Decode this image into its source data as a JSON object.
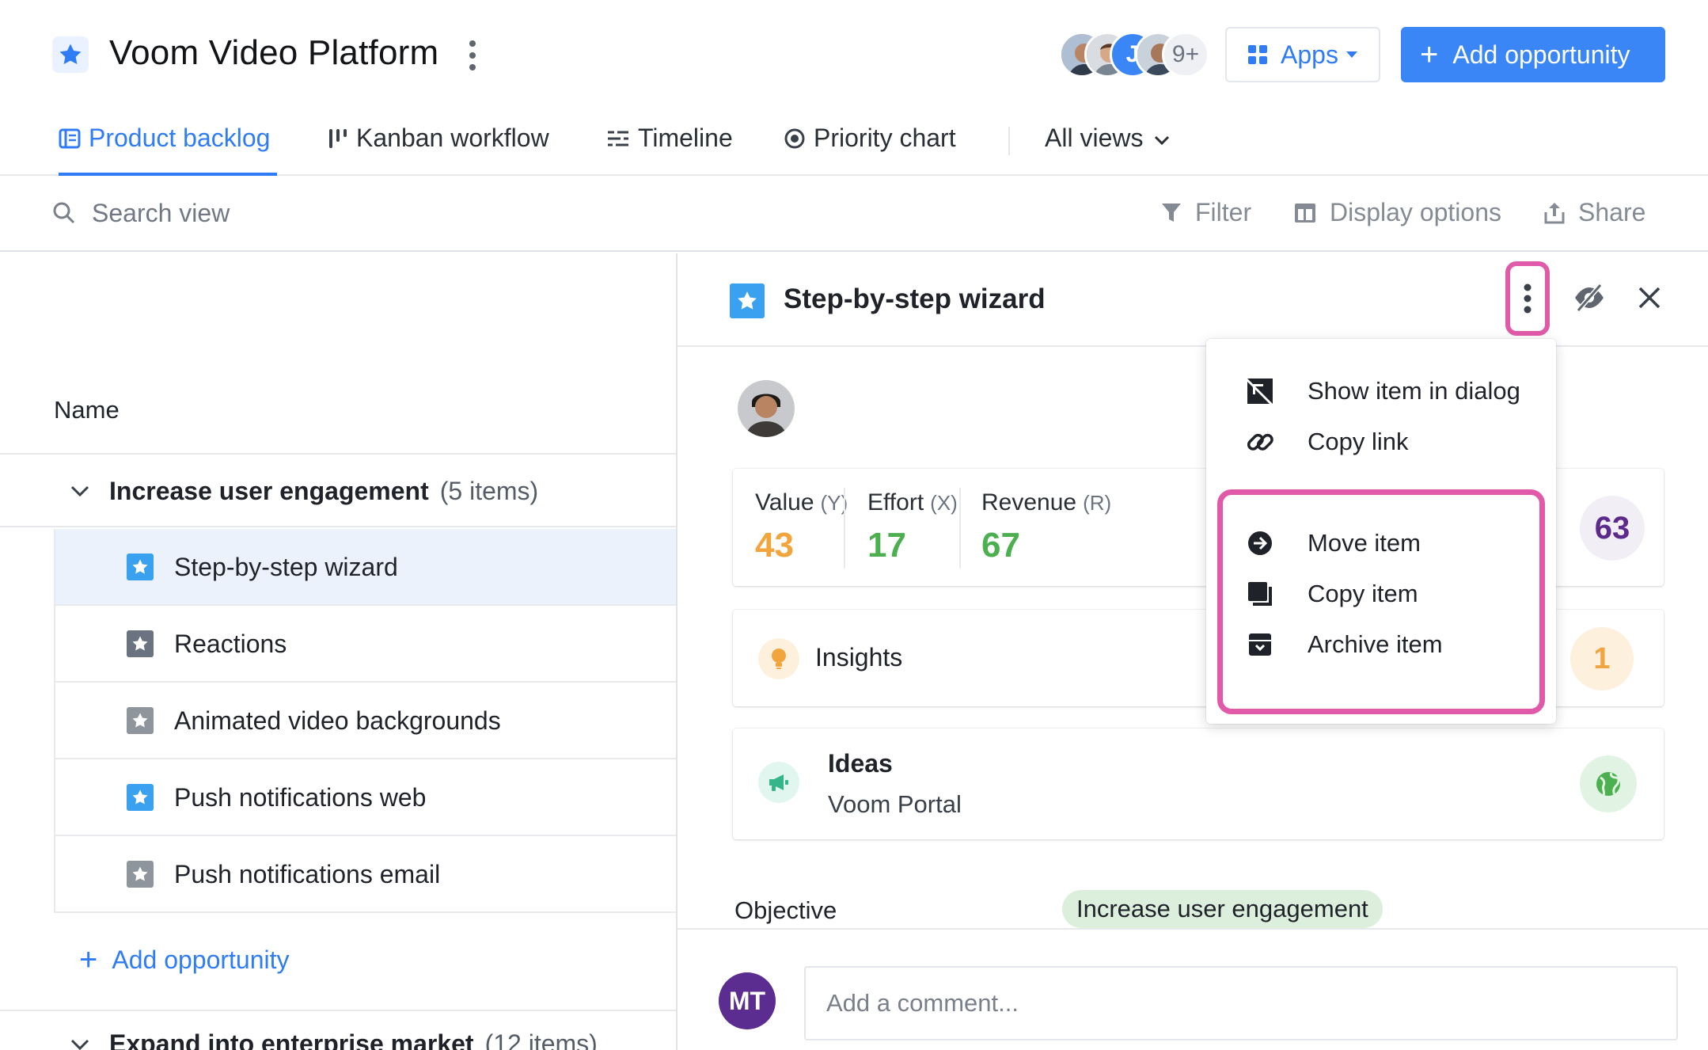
{
  "header": {
    "project_title": "Voom Video Platform",
    "avatars_more": "9+",
    "apps_label": "Apps",
    "add_opportunity_label": "Add opportunity"
  },
  "tabs": [
    {
      "label": "Product backlog",
      "icon": "list-icon",
      "active": true
    },
    {
      "label": "Kanban workflow",
      "icon": "kanban-icon"
    },
    {
      "label": "Timeline",
      "icon": "timeline-icon"
    },
    {
      "label": "Priority chart",
      "icon": "target-icon"
    },
    {
      "label": "All views",
      "icon": "chevron-down-icon"
    }
  ],
  "toolbar": {
    "search_placeholder": "Search view",
    "filter_label": "Filter",
    "display_options_label": "Display options",
    "share_label": "Share"
  },
  "backlog": {
    "column_name": "Name",
    "group": {
      "title": "Increase user engagement",
      "count": "(5 items)"
    },
    "items": [
      {
        "label": "Step-by-step wizard",
        "star_color": "#3aa0f0",
        "selected": true
      },
      {
        "label": "Reactions",
        "star_color": "#6b7380"
      },
      {
        "label": "Animated video backgrounds",
        "star_color": "#8f959d"
      },
      {
        "label": "Push notifications web",
        "star_color": "#3aa0f0"
      },
      {
        "label": "Push notifications email",
        "star_color": "#8f959d"
      }
    ],
    "add_opportunity_label": "Add opportunity",
    "group2": {
      "title": "Expand into enterprise market",
      "count": "(12 items)"
    }
  },
  "detail": {
    "title": "Step-by-step wizard",
    "metrics": [
      {
        "label": "Value",
        "axis": "(Y)",
        "value": "43",
        "color": "#f2a53c"
      },
      {
        "label": "Effort",
        "axis": "(X)",
        "value": "17",
        "color": "#4caf50"
      },
      {
        "label": "Revenue",
        "axis": "(R)",
        "value": "67",
        "color": "#4caf50"
      }
    ],
    "score": "63",
    "insights_label": "Insights",
    "insights_count": "1",
    "ideas_title": "Ideas",
    "ideas_source": "Voom Portal",
    "objective_label": "Objective",
    "objective_value": "Increase user engagement",
    "commenter_initials": "MT",
    "comment_placeholder": "Add a comment..."
  },
  "menu": {
    "items": [
      {
        "label": "Show item in dialog",
        "icon": "expand-icon"
      },
      {
        "label": "Copy link",
        "icon": "link-icon"
      },
      {
        "label": "Move item",
        "icon": "arrow-circle-icon"
      },
      {
        "label": "Copy item",
        "icon": "copy-icon"
      },
      {
        "label": "Archive item",
        "icon": "archive-icon"
      }
    ]
  },
  "colors": {
    "accent": "#3b86f7",
    "highlight": "#e15aa9",
    "selected_row": "#ebf2fc"
  }
}
